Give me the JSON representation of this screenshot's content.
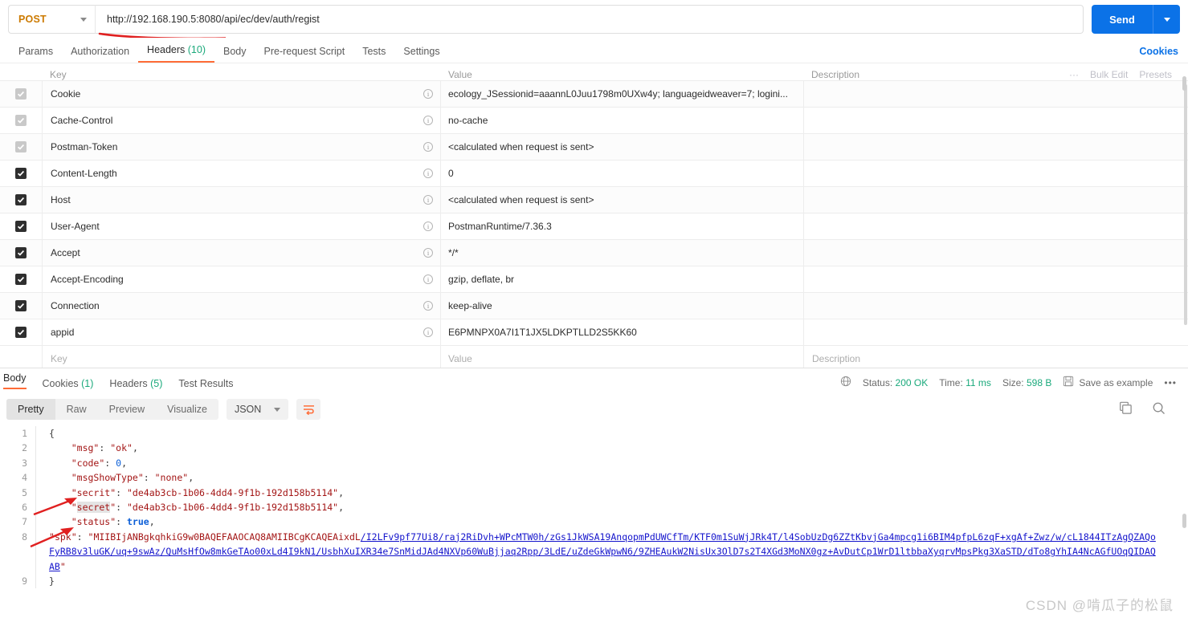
{
  "request": {
    "method": "POST",
    "url": "http://192.168.190.5:8080/api/ec/dev/auth/regist",
    "send_label": "Send",
    "tabs": [
      {
        "label": "Params",
        "count": ""
      },
      {
        "label": "Authorization",
        "count": ""
      },
      {
        "label": "Headers",
        "count": " (10)"
      },
      {
        "label": "Body",
        "count": ""
      },
      {
        "label": "Pre-request Script",
        "count": ""
      },
      {
        "label": "Tests",
        "count": ""
      },
      {
        "label": "Settings",
        "count": ""
      }
    ],
    "cookies_link": "Cookies",
    "bulk_edit": "Bulk Edit",
    "presets": "Presets"
  },
  "headers_table": {
    "columns": {
      "key": "Key",
      "value": "Value",
      "description": "Description"
    },
    "rows": [
      {
        "checked": "dim",
        "key": "Cookie",
        "value": "ecology_JSessionid=aaannL0Juu1798m0UXw4y; languageidweaver=7; logini...",
        "description": ""
      },
      {
        "checked": "dim",
        "key": "Cache-Control",
        "value": "no-cache",
        "description": ""
      },
      {
        "checked": "dim",
        "key": "Postman-Token",
        "value": "<calculated when request is sent>",
        "description": ""
      },
      {
        "checked": "on",
        "key": "Content-Length",
        "value": "0",
        "description": ""
      },
      {
        "checked": "on",
        "key": "Host",
        "value": "<calculated when request is sent>",
        "description": ""
      },
      {
        "checked": "on",
        "key": "User-Agent",
        "value": "PostmanRuntime/7.36.3",
        "description": ""
      },
      {
        "checked": "on",
        "key": "Accept",
        "value": "*/*",
        "description": ""
      },
      {
        "checked": "on",
        "key": "Accept-Encoding",
        "value": "gzip, deflate, br",
        "description": ""
      },
      {
        "checked": "on",
        "key": "Connection",
        "value": "keep-alive",
        "description": ""
      },
      {
        "checked": "on",
        "key": "appid",
        "value": "E6PMNPX0A7I1T1JX5LDKPTLLD2S5KK60",
        "description": ""
      }
    ],
    "placeholder_row": {
      "key": "Key",
      "value": "Value",
      "description": "Description"
    }
  },
  "response": {
    "tabs": [
      {
        "label": "Body",
        "count": ""
      },
      {
        "label": "Cookies",
        "count": " (1)"
      },
      {
        "label": "Headers",
        "count": " (5)"
      },
      {
        "label": "Test Results",
        "count": ""
      }
    ],
    "status_label": "Status:",
    "status_value": "200 OK",
    "time_label": "Time:",
    "time_value": "11 ms",
    "size_label": "Size:",
    "size_value": "598 B",
    "save_as_example": "Save as example",
    "view_modes": [
      "Pretty",
      "Raw",
      "Preview",
      "Visualize"
    ],
    "active_view": "Pretty",
    "format": "JSON"
  },
  "body_json": {
    "lines": [
      {
        "n": "1",
        "text": "{"
      },
      {
        "n": "2",
        "text": "    \"msg\": \"ok\","
      },
      {
        "n": "3",
        "text": "    \"code\": 0,"
      },
      {
        "n": "4",
        "text": "    \"msgShowType\": \"none\","
      },
      {
        "n": "5",
        "text": "    \"secrit\": \"de4ab3cb-1b06-4dd4-9f1b-192d158b5114\","
      },
      {
        "n": "6",
        "text": "    \"secret\": \"de4ab3cb-1b06-4dd4-9f1b-192d158b5114\","
      },
      {
        "n": "7",
        "text": "    \"status\": true,"
      },
      {
        "n": "8",
        "text": "    \"spk\": \"MIIBIjANBgkqhkiG9w0BAQEFAAOCAQ8AMIIBCgKCAQEAixdL/I2LFv9pf77Ui8/raj2RiDvh+WPcMTW0h/zGs1JkWSA19AnqopmPdUWCfTm/KTF0m1SuWjJRk4T/l4SobUzDg6ZZtKbvjGa4mpcg1i6BIM4pfpL6zqF+xgAf+Zwz/w/cL1844ITzAgQZAQoFyRB8v3luGK/uq+9swAz/QuMsHfOw8mkGeTAo00xLd4I9kN1/UsbhXuIXR34e7SnMidJAd4NXVp60WuBjjaq2Rpp/3LdE/uZdeGkWpwN6/9ZHEAukW2NisUx3OlD7s2T4XGd3MoNX0gz+AvDutCp1WrD1ltbbaXyqrvMpsPkg3XaSTD/dTo8gYhIA4NcAGfUOqQIDAQAB\""
      },
      {
        "n": "9",
        "text": "}"
      }
    ],
    "keys": {
      "msg": "msg",
      "msg_val": "ok",
      "code": "code",
      "code_val": "0",
      "msgShowType": "msgShowType",
      "msgShowType_val": "none",
      "secrit": "secrit",
      "secrit_val": "de4ab3cb-1b06-4dd4-9f1b-192d158b5114",
      "secret": "secret",
      "secret_val": "de4ab3cb-1b06-4dd4-9f1b-192d158b5114",
      "status": "status",
      "status_val": "true",
      "spk": "spk",
      "spk_line1": "MIIBIjANBgkqhkiG9w0BAQEFAAOCAQ8AMIIBCgKCAQEAixdL",
      "spk_line1b": "/I2LFv9pf77Ui8/raj2RiDvh+WPcMTW0h/zGs1JkWSA19AnqopmPdUWCfTm/KTF0m1SuWjJRk4T/l4SobUzDg6ZZtKbvjGa4mpcg1i6BIM4pfpL6zqF+xgAf+Zwz/w/",
      "spk_line2": "cL1844ITzAgQZAQoFyRB8v3luGK/uq+9swAz/QuMsHfOw8mkGeTAo00xLd4I9kN1/UsbhXuIXR34e7SnMidJAd4NXVp60WuBjjaq2Rpp/3LdE/uZdeGkWpwN6/9ZHEAukW2NisUx3OlD7s2T4XGd3MoNX0gz",
      "spk_line3": "+AvDutCp1WrD1ltbbaXyqrvMpsPkg3XaSTD/dTo8gYhIA4NcAGfUOqQIDAQAB"
    },
    "line_numbers": [
      "1",
      "2",
      "3",
      "4",
      "5",
      "6",
      "7",
      "8",
      "9"
    ]
  },
  "watermark": "CSDN @啃瓜子的松鼠",
  "colors": {
    "accent": "#ff6c37",
    "send": "#0b72e7",
    "status_ok": "#1aa97b",
    "highlight": "#e02020",
    "method": "#cc7a00"
  }
}
